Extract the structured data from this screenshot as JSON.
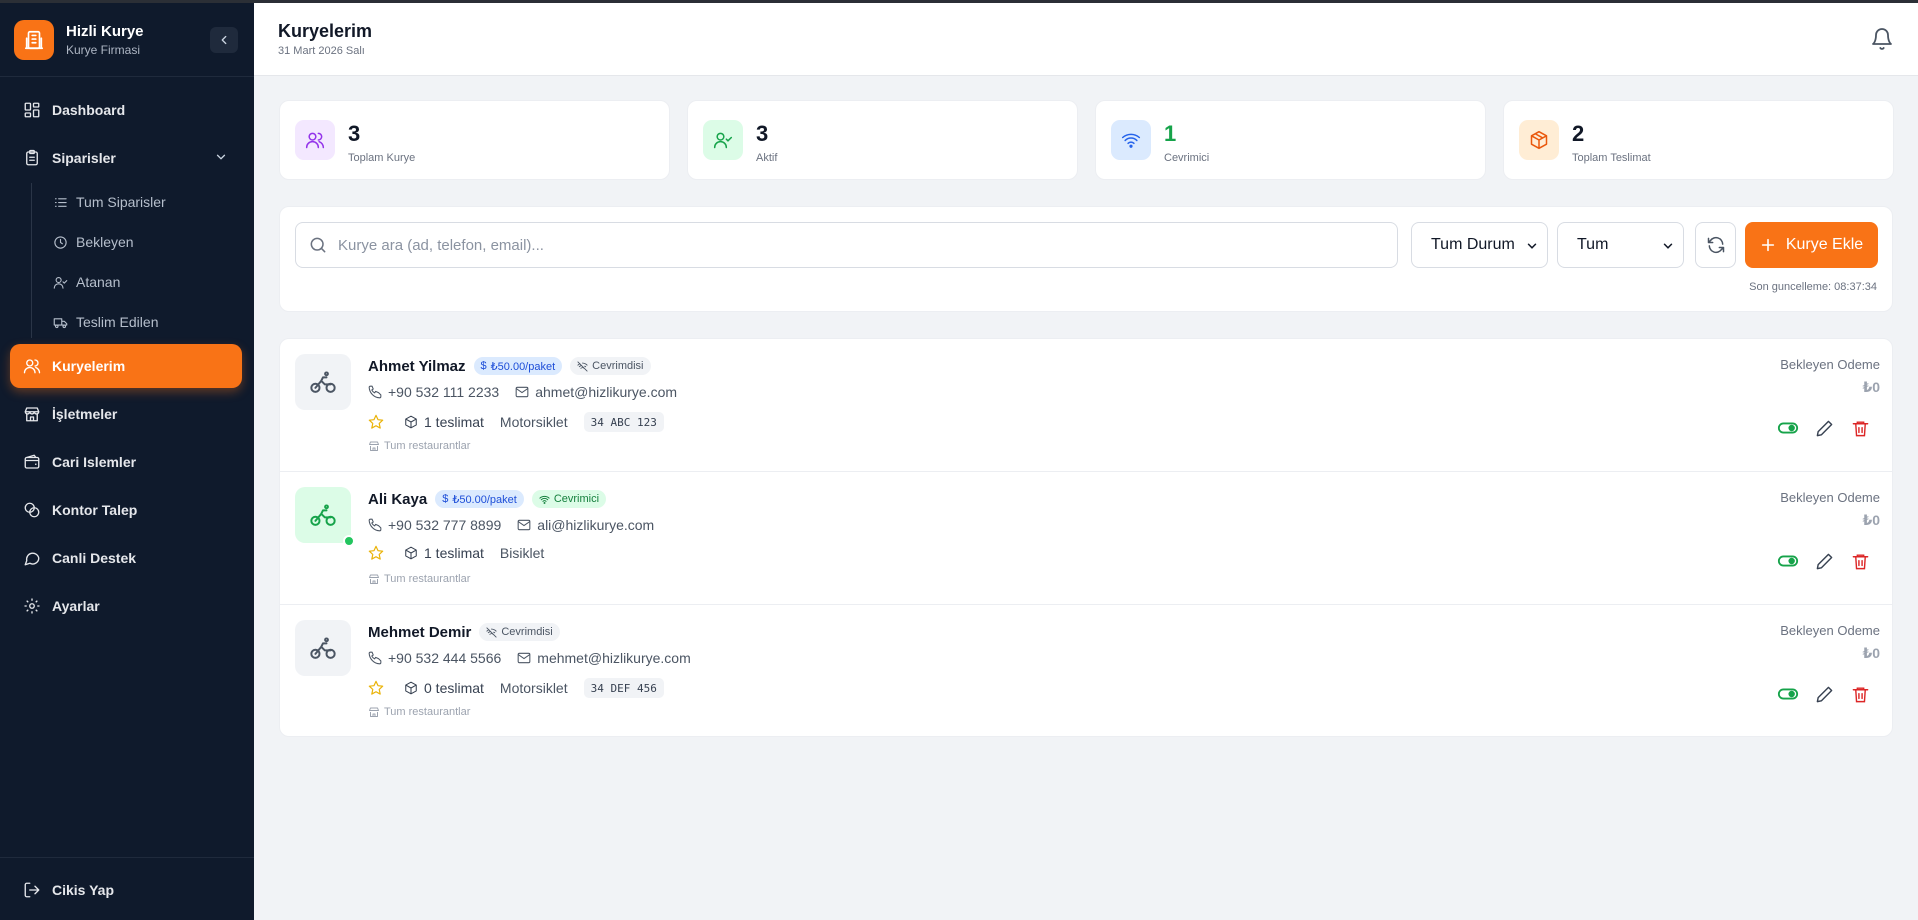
{
  "brand": {
    "name": "Hizli Kurye",
    "subtitle": "Kurye Firmasi"
  },
  "sidebar": {
    "items": [
      {
        "label": "Dashboard",
        "icon": "dashboard-icon"
      },
      {
        "label": "Siparisler",
        "icon": "clipboard-icon",
        "expanded": true
      },
      {
        "label": "Kuryelerim",
        "icon": "users-icon",
        "active": true
      },
      {
        "label": "İşletmeler",
        "icon": "store-icon"
      },
      {
        "label": "Cari Islemler",
        "icon": "wallet-icon"
      },
      {
        "label": "Kontor Talep",
        "icon": "coins-icon"
      },
      {
        "label": "Canli Destek",
        "icon": "chat-icon"
      },
      {
        "label": "Ayarlar",
        "icon": "gear-icon"
      }
    ],
    "sub_items": [
      {
        "label": "Tum Siparisler",
        "icon": "list-icon"
      },
      {
        "label": "Bekleyen",
        "icon": "clock-icon"
      },
      {
        "label": "Atanan",
        "icon": "user-check-icon"
      },
      {
        "label": "Teslim Edilen",
        "icon": "truck-icon"
      }
    ],
    "logout": "Cikis Yap"
  },
  "header": {
    "title": "Kuryelerim",
    "date": "31 Mart 2026 Salı"
  },
  "stats": [
    {
      "value": "3",
      "label": "Toplam Kurye",
      "color": "#9333ea"
    },
    {
      "value": "3",
      "label": "Aktif",
      "color": "#16a34a"
    },
    {
      "value": "1",
      "label": "Cevrimici",
      "color": "#16a34a"
    },
    {
      "value": "2",
      "label": "Toplam Teslimat",
      "color": "#ea580c"
    }
  ],
  "filters": {
    "search_placeholder": "Kurye ara (ad, telefon, email)...",
    "status_select": "Tum Durum",
    "type_select": "Tum",
    "add_button": "Kurye Ekle",
    "last_update": "Son guncelleme: 08:37:34"
  },
  "couriers": [
    {
      "name": "Ahmet Yilmaz",
      "price": "₺50.00/paket",
      "status": "Cevrimdisi",
      "online": false,
      "phone": "+90 532 111 2233",
      "email": "ahmet@hizlikurye.com",
      "deliveries": "1 teslimat",
      "vehicle": "Motorsiklet",
      "plate": "34 ABC 123",
      "restaurants": "Tum restaurantlar",
      "pending_label": "Bekleyen Odeme",
      "pending_value": "₺0"
    },
    {
      "name": "Ali Kaya",
      "price": "₺50.00/paket",
      "status": "Cevrimici",
      "online": true,
      "phone": "+90 532 777 8899",
      "email": "ali@hizlikurye.com",
      "deliveries": "1 teslimat",
      "vehicle": "Bisiklet",
      "restaurants": "Tum restaurantlar",
      "pending_label": "Bekleyen Odeme",
      "pending_value": "₺0"
    },
    {
      "name": "Mehmet Demir",
      "status": "Cevrimdisi",
      "online": false,
      "phone": "+90 532 444 5566",
      "email": "mehmet@hizlikurye.com",
      "deliveries": "0 teslimat",
      "vehicle": "Motorsiklet",
      "plate": "34 DEF 456",
      "restaurants": "Tum restaurantlar",
      "pending_label": "Bekleyen Odeme",
      "pending_value": "₺0"
    }
  ],
  "colors": {
    "accent": "#f97316",
    "sidebar_bg": "#0f1a2c",
    "online": "#22c55e",
    "danger": "#dc2626"
  }
}
